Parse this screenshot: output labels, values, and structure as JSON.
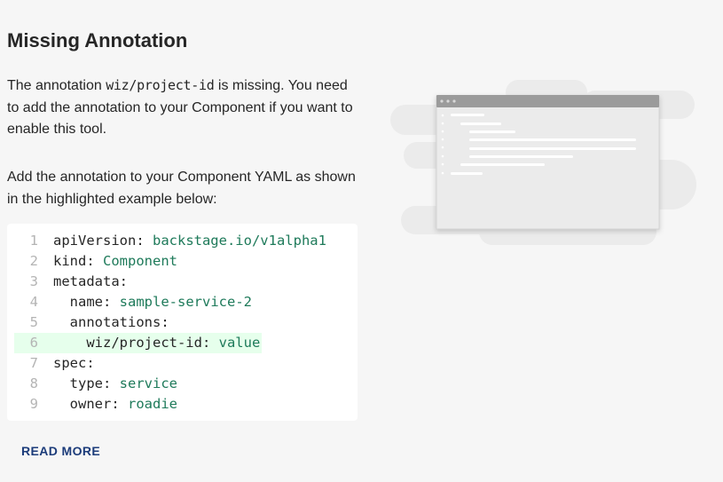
{
  "page": {
    "title": "Missing Annotation",
    "paragraph1": {
      "before": "The annotation ",
      "code": "wiz/project-id",
      "after": " is missing. You need to add the annotation to your Component if you want to enable this tool."
    },
    "paragraph2": "Add the annotation to your Component YAML as shown in the highlighted example below:"
  },
  "code_example": {
    "lines": [
      {
        "n": "1",
        "indent": "",
        "key": "apiVersion:",
        "value": " backstage.io/v1alpha1"
      },
      {
        "n": "2",
        "indent": "",
        "key": "kind:",
        "value": " Component"
      },
      {
        "n": "3",
        "indent": "",
        "key": "metadata:",
        "value": ""
      },
      {
        "n": "4",
        "indent": "  ",
        "key": "name:",
        "value": " sample-service-2"
      },
      {
        "n": "5",
        "indent": "  ",
        "key": "annotations:",
        "value": ""
      },
      {
        "n": "6",
        "indent": "    ",
        "key": "wiz/project-id:",
        "value": " value",
        "highlight": true
      },
      {
        "n": "7",
        "indent": "",
        "key": "spec:",
        "value": ""
      },
      {
        "n": "8",
        "indent": "  ",
        "key": "type:",
        "value": " service"
      },
      {
        "n": "9",
        "indent": "  ",
        "key": "owner:",
        "value": " roadie"
      }
    ],
    "highlight_color": "#e6ffec",
    "value_color": "#1e7a5a"
  },
  "actions": {
    "read_more_label": "READ MORE"
  },
  "illustration": {
    "icon": "code-window-illustration"
  }
}
